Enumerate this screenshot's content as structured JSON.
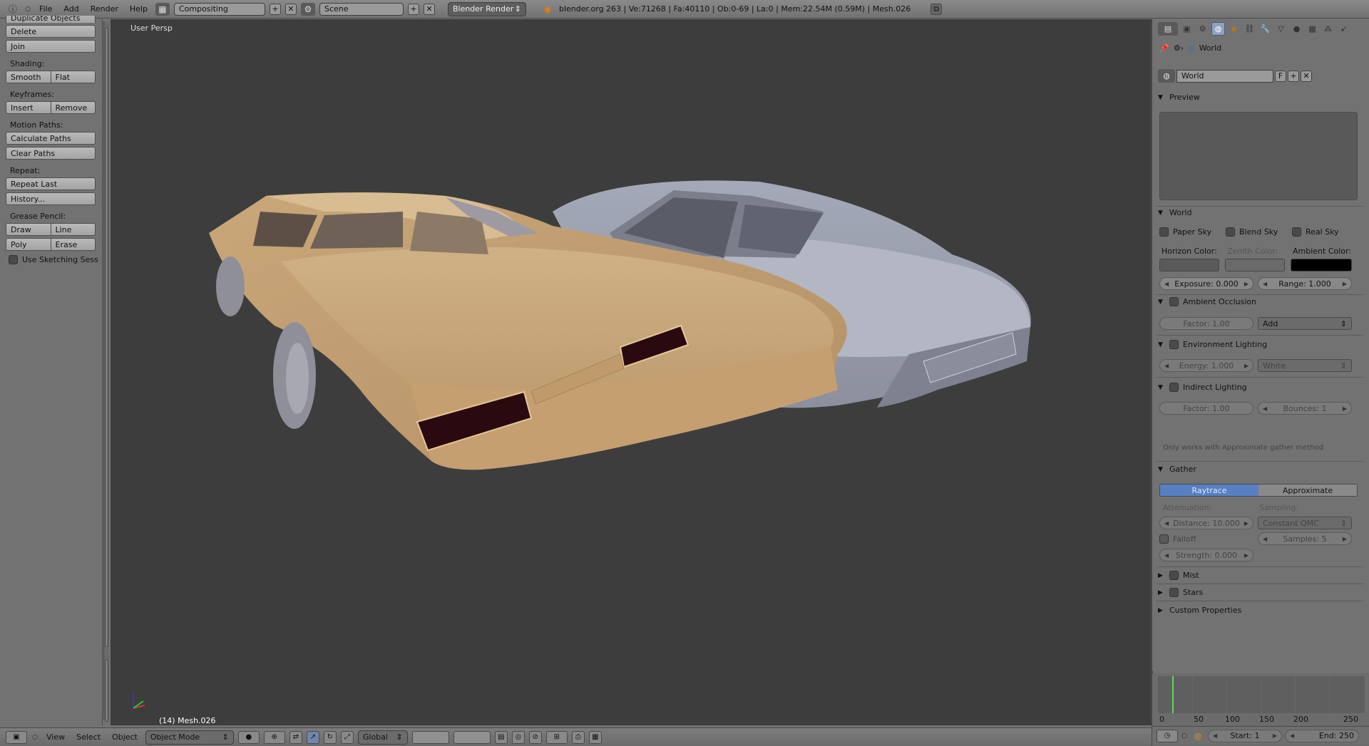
{
  "topbar": {
    "menus": [
      "File",
      "Add",
      "Render",
      "Help"
    ],
    "layout": "Compositing",
    "scene": "Scene",
    "engine": "Blender Render",
    "stats": "blender.org 263 | Ve:71268 | Fa:40110 | Ob:0-69 | La:0 | Mem:22.54M (0.59M) | Mesh.026"
  },
  "left_panel": {
    "top_partial": "Duplicate Objects",
    "rows": [
      {
        "type": "button",
        "labels": [
          "Delete"
        ]
      },
      {
        "type": "button",
        "labels": [
          "Join"
        ]
      },
      {
        "type": "section",
        "label": "Shading:"
      },
      {
        "type": "button",
        "labels": [
          "Smooth",
          "Flat"
        ]
      },
      {
        "type": "section",
        "label": "Keyframes:"
      },
      {
        "type": "button",
        "labels": [
          "Insert",
          "Remove"
        ]
      },
      {
        "type": "section",
        "label": "Motion Paths:"
      },
      {
        "type": "button",
        "labels": [
          "Calculate Paths"
        ]
      },
      {
        "type": "button",
        "labels": [
          "Clear Paths"
        ]
      },
      {
        "type": "section",
        "label": "Repeat:"
      },
      {
        "type": "button",
        "labels": [
          "Repeat Last"
        ]
      },
      {
        "type": "button",
        "labels": [
          "History..."
        ]
      },
      {
        "type": "section",
        "label": "Grease Pencil:"
      },
      {
        "type": "button",
        "labels": [
          "Draw",
          "Line"
        ]
      },
      {
        "type": "button",
        "labels": [
          "Poly",
          "Erase"
        ]
      }
    ],
    "sketch_check": "Use Sketching Sessio"
  },
  "viewport": {
    "label": "User Persp",
    "object_info": "(14) Mesh.026"
  },
  "bottombar": {
    "menus": [
      "View",
      "Select",
      "Object"
    ],
    "mode": "Object Mode",
    "orientation": "Global"
  },
  "properties": {
    "breadcrumb": "World",
    "world_field": "World",
    "fake_user": "F",
    "preview_label": "Preview",
    "world_label": "World",
    "paper_sky": "Paper Sky",
    "blend_sky": "Blend Sky",
    "real_sky": "Real Sky",
    "horizon_color": "Horizon Color:",
    "zenith_color": "Zenith Color:",
    "ambient_color": "Ambient Color:",
    "exposure": "Exposure: 0.000",
    "range": "Range: 1.000",
    "ao_label": "Ambient Occlusion",
    "ao_factor": "Factor: 1.00",
    "ao_blend": "Add",
    "env_label": "Environment Lighting",
    "env_energy": "Energy: 1.000",
    "env_color": "White",
    "indirect_label": "Indirect Lighting",
    "ind_factor": "Factor: 1.00",
    "ind_bounces": "Bounces: 1",
    "note": "Only works with Approximate gather method",
    "gather_label": "Gather",
    "raytrace": "Raytrace",
    "approximate": "Approximate",
    "attenuation": "Attenuation:",
    "sampling": "Sampling:",
    "distance": "Distance: 10.000",
    "sampling_method": "Constant QMC",
    "falloff": "Falloff",
    "samples": "Samples: 5",
    "strength": "Strength: 0.000",
    "mist": "Mist",
    "stars": "Stars",
    "custom": "Custom Properties"
  },
  "timeline": {
    "ticks": [
      "0",
      "50",
      "100",
      "150",
      "200",
      "250"
    ],
    "start": "Start: 1",
    "end": "End: 250"
  },
  "colors": {
    "car_front": "#d1b080",
    "car_back": "#9a9fb0",
    "viewport_bg": "#3d3d3d",
    "accent": "#5680c2"
  }
}
